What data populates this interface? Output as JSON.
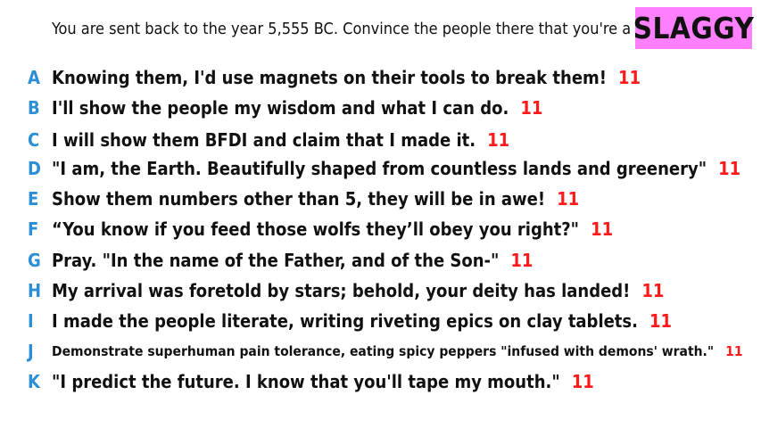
{
  "prompt": "You are sent back to the year 5,555 BC. Convince the people there that you're a god.",
  "badge": {
    "label": "SLAGGY",
    "color": "#ff80ff"
  },
  "colors": {
    "letter": "#2b8fd6",
    "score": "#ff1a1a",
    "text": "#111111"
  },
  "answers": [
    {
      "letter": "A",
      "text": "Knowing them, I'd use magnets on their tools to break them!",
      "score": "11"
    },
    {
      "letter": "B",
      "text": "I'll show the people my wisdom and what I can do.",
      "score": "11"
    },
    {
      "letter": "C",
      "text": "I will show them BFDI and claim that I made it.",
      "score": "11"
    },
    {
      "letter": "D",
      "text": "\"I am, the Earth. Beautifully shaped from countless lands and greenery\"",
      "score": "11"
    },
    {
      "letter": "E",
      "text": "Show them numbers other than 5, they will be in awe!",
      "score": "11"
    },
    {
      "letter": "F",
      "text": "“You know if you feed those wolfs they’ll obey you right?\"",
      "score": "11"
    },
    {
      "letter": "G",
      "text": "Pray. \"In the name of the Father, and of the Son-\"",
      "score": "11"
    },
    {
      "letter": "H",
      "text": "My arrival was foretold by stars; behold, your deity has landed!",
      "score": "11"
    },
    {
      "letter": "I",
      "text": "I made the people literate, writing riveting epics on clay tablets.",
      "score": "11"
    },
    {
      "letter": "J",
      "text": "Demonstrate superhuman pain tolerance, eating spicy peppers \"infused with demons' wrath.\"",
      "score": "11"
    },
    {
      "letter": "K",
      "text": "\"I predict the future. I know that you'll tape my mouth.\"",
      "score": "11"
    }
  ]
}
